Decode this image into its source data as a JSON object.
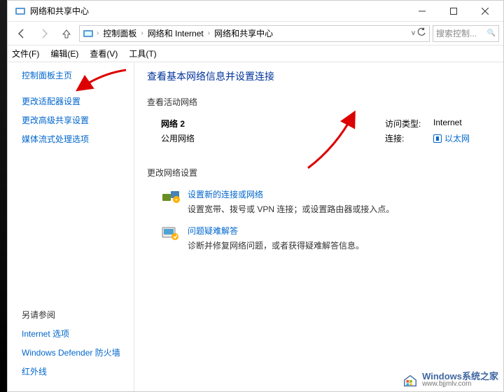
{
  "titlebar": {
    "title": "网络和共享中心"
  },
  "breadcrumb": {
    "c1": "控制面板",
    "c2": "网络和 Internet",
    "c3": "网络和共享中心"
  },
  "search": {
    "placeholder": "搜索控制...",
    "icon": "🔍"
  },
  "menu": {
    "file": "文件(F)",
    "edit": "编辑(E)",
    "view": "查看(V)",
    "tools": "工具(T)"
  },
  "sidebar": {
    "home": "控制面板主页",
    "links": [
      "更改适配器设置",
      "更改高级共享设置",
      "媒体流式处理选项"
    ],
    "see_also": "另请参阅",
    "see_links": [
      "Internet 选项",
      "Windows Defender 防火墙",
      "红外线"
    ]
  },
  "content": {
    "heading": "查看基本网络信息并设置连接",
    "active_hdr": "查看活动网络",
    "network": {
      "name": "网络 2",
      "type": "公用网络"
    },
    "access_k": "访问类型:",
    "access_v": "Internet",
    "conn_k": "连接:",
    "conn_v": "以太网",
    "change_hdr": "更改网络设置",
    "act1_title": "设置新的连接或网络",
    "act1_desc": "设置宽带、拨号或 VPN 连接；或设置路由器或接入点。",
    "act2_title": "问题疑难解答",
    "act2_desc": "诊断并修复网络问题，或者获得疑难解答信息。"
  },
  "watermark": {
    "site": "Windows系统之家",
    "url": "www.bjjmlv.com"
  }
}
